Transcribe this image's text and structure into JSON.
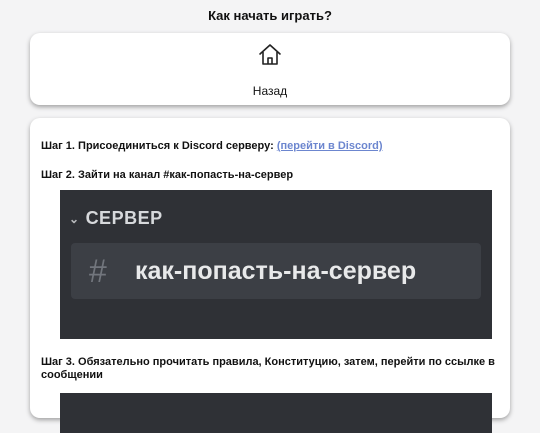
{
  "page": {
    "title": "Как начать играть?"
  },
  "back_card": {
    "icon": "home-icon",
    "label": "Назад"
  },
  "steps": [
    {
      "text": "Шаг 1. Присоединиться к Discord серверу: ",
      "link_text": "(перейти в Discord)",
      "link_color": "#6c86cf"
    },
    {
      "text": "Шаг 2. Зайти на канал #как-попасть-на-сервер"
    },
    {
      "text": "Шаг 3. Обязательно прочитать правила, Конституцию, затем, перейти по ссылке в сообщении"
    }
  ],
  "discord_image": {
    "header": "СЕРВЕР",
    "header_icon": "chevron-down-icon",
    "channel_icon": "hash-icon",
    "channel": "как-попасть-на-сервер",
    "background": "#2f3136"
  }
}
